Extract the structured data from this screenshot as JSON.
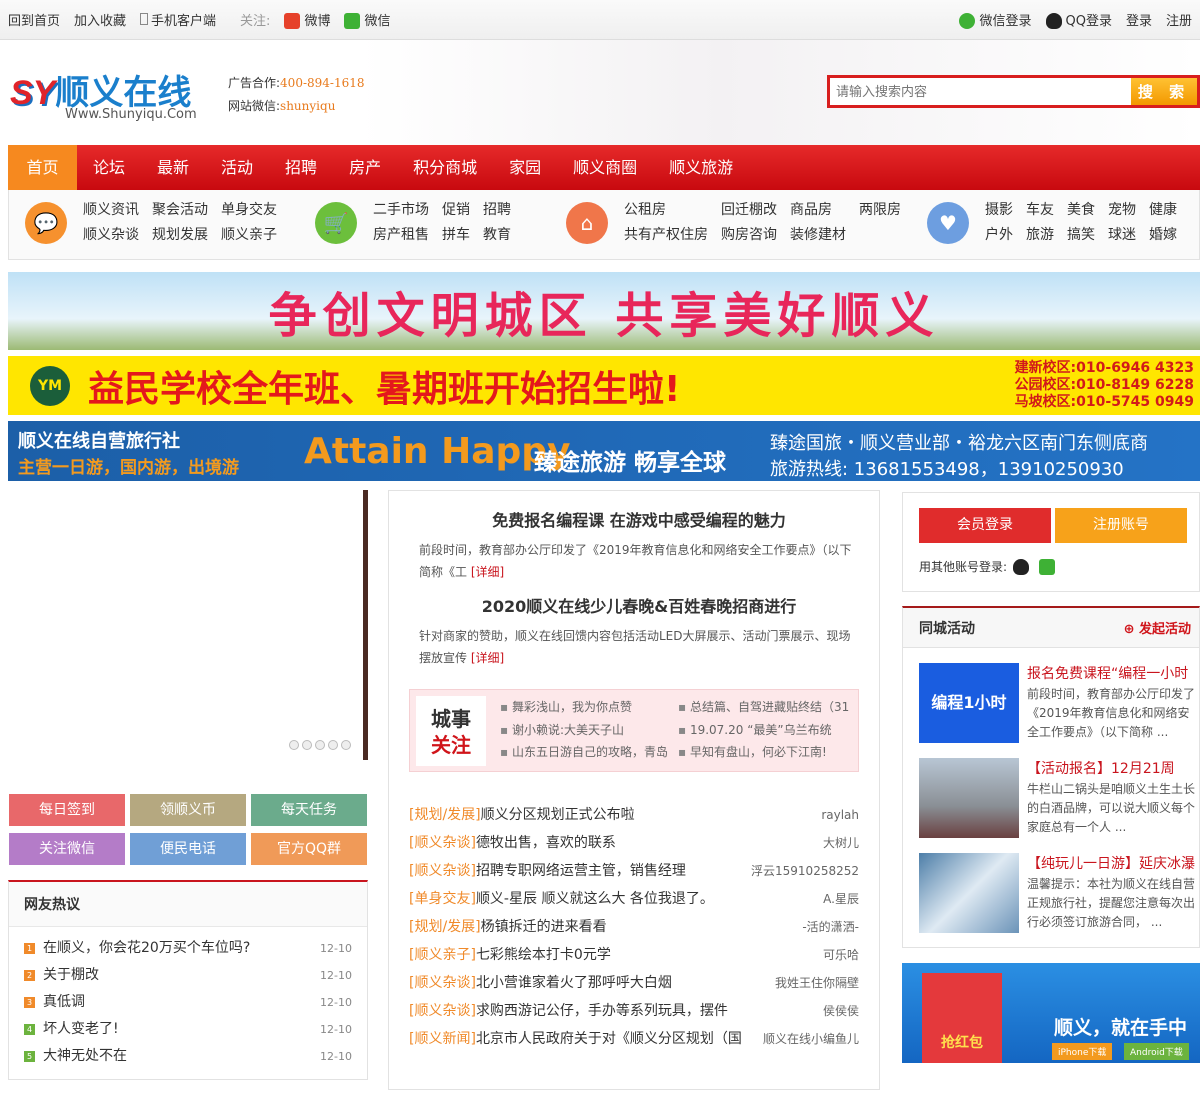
{
  "topbar": {
    "home": "回到首页",
    "fav": "加入收藏",
    "mobile": "手机客户端",
    "follow": "关注:",
    "weibo": "微博",
    "weixin": "微信",
    "wx_login": "微信登录",
    "qq_login": "QQ登录",
    "login": "登录",
    "register": "注册"
  },
  "header": {
    "logo_mark": "SY",
    "logo_name": "顺义在线",
    "logo_url": "Www.Shunyiqu.Com",
    "ad_label": "广告合作:",
    "ad_phone": "400-894-1618",
    "wx_label": "网站微信:",
    "wx_id": "shunyiqu",
    "search_placeholder": "请输入搜索内容",
    "search_button": "搜 索"
  },
  "nav": [
    "首页",
    "论坛",
    "最新",
    "活动",
    "招聘",
    "房产",
    "积分商城",
    "家园",
    "顺义商圈",
    "顺义旅游"
  ],
  "cats": [
    {
      "links": [
        "顺义资讯",
        "聚会活动",
        "单身交友",
        "顺义杂谈",
        "规划发展",
        "顺义亲子"
      ],
      "color": "#f6912e"
    },
    {
      "links": [
        "二手市场",
        "促销",
        "招聘",
        "房产租售",
        "拼车",
        "教育"
      ],
      "color": "#6cbf3c"
    },
    {
      "links": [
        "公租房",
        "回迁棚改",
        "商品房",
        "两限房",
        "共有产权住房",
        "购房咨询",
        "装修建材"
      ],
      "color": "#f0764a"
    },
    {
      "links": [
        "摄影",
        "车友",
        "美食",
        "宠物",
        "健康",
        "户外",
        "旅游",
        "搞笑",
        "球迷",
        "婚嫁"
      ],
      "color": "#6d9ee0"
    }
  ],
  "banners": {
    "b1": "争创文明城区  共享美好顺义",
    "b2_logo": "YM",
    "b2": "益民学校全年班、暑期班开始招生啦!",
    "b2_phones": [
      "建新校区:010-6946 4323",
      "公园校区:010-8149 6228",
      "马坡校区:010-5745 0949"
    ],
    "b3_title": "顺义在线自营旅行社",
    "b3_sub": "主营一日游，国内游，出境游",
    "b3_brand": "Attain Happy",
    "b3_slogan": "臻途旅游  畅享全球",
    "b3_addr": "臻途国旅・顺义营业部・裕龙六区南门东侧底商",
    "b3_hotline": "旅游热线: 13681553498，13910250930"
  },
  "quick": [
    {
      "label": "每日签到",
      "color": "#e8686a"
    },
    {
      "label": "领顺义币",
      "color": "#b5a880"
    },
    {
      "label": "每天任务",
      "color": "#6bab8c"
    },
    {
      "label": "关注微信",
      "color": "#b47cc8"
    },
    {
      "label": "便民电话",
      "color": "#709fd6"
    },
    {
      "label": "官方QQ群",
      "color": "#f09a58"
    }
  ],
  "hot": {
    "title": "网友热议",
    "items": [
      {
        "t": "在顺义，你会花20万买个车位吗?",
        "d": "12-10",
        "n": "1",
        "c": "#f08a2a"
      },
      {
        "t": "关于棚改",
        "d": "12-10",
        "n": "2",
        "c": "#f08a2a"
      },
      {
        "t": "真低调",
        "d": "12-10",
        "n": "3",
        "c": "#f08a2a"
      },
      {
        "t": "坏人变老了!",
        "d": "12-10",
        "n": "4",
        "c": "#6cb33e"
      },
      {
        "t": "大神无处不在",
        "d": "12-10",
        "n": "5",
        "c": "#6cb33e"
      }
    ]
  },
  "articles": [
    {
      "title": "免费报名编程课  在游戏中感受编程的魅力",
      "desc": "前段时间，教育部办公厅印发了《2019年教育信息化和网络安全工作要点》（以下简称《工",
      "more": "[详细]"
    },
    {
      "title": "2020顺义在线少儿春晚&百姓春晚招商进行",
      "desc": "针对商家的赞助，顺义在线回馈内容包括活动LED大屏展示、活动门票展示、现场摆放宣传",
      "more": "[详细]"
    }
  ],
  "focus": {
    "l1": "城事",
    "l2": "关注",
    "items": [
      "舞彩浅山，我为你点赞",
      "总结篇、自驾进藏贴终结（31",
      "谢小赖说:大美天子山",
      "19.07.20 “最美”乌兰布统",
      "山东五日游自己的攻略，青岛",
      "早知有盘山，何必下江南!"
    ]
  },
  "threads": [
    {
      "c": "[规划/发展]",
      "t": "顺义分区规划正式公布啦",
      "u": "raylah"
    },
    {
      "c": "[顺义杂谈]",
      "t": "德牧出售，喜欢的联系",
      "u": "大树儿"
    },
    {
      "c": "[顺义杂谈]",
      "t": "招聘专职网络运营主管，销售经理",
      "u": "浮云15910258252"
    },
    {
      "c": "[单身交友]",
      "t": "顺义-星辰 顺义就这么大 各位我退了。",
      "u": "A.星辰"
    },
    {
      "c": "[规划/发展]",
      "t": "杨镇拆迁的进来看看",
      "u": "-活的潇洒-"
    },
    {
      "c": "[顺义亲子]",
      "t": "七彩熊绘本打卡0元学",
      "u": "可乐哈"
    },
    {
      "c": "[顺义杂谈]",
      "t": "北小营谁家着火了那呼呼大白烟",
      "u": "我姓王住你隔壁"
    },
    {
      "c": "[顺义杂谈]",
      "t": "求购西游记公仔，手办等系列玩具，摆件",
      "u": "侯侯侯"
    },
    {
      "c": "[顺义新闻]",
      "t": "北京市人民政府关于对《顺义分区规划（国",
      "u": "顺义在线小编鱼儿"
    }
  ],
  "login": {
    "member": "会员登录",
    "register": "注册账号",
    "other": "用其他账号登录:"
  },
  "activities": {
    "title": "同城活动",
    "create": "发起活动",
    "items": [
      {
        "title": "报名免费课程“编程一小时",
        "desc": "前段时间，教育部办公厅印发了《2019年教育信息化和网络安全工作要点》（以下简称 ...",
        "img": "编程1小时"
      },
      {
        "title": "【活动报名】12月21周",
        "desc": "牛栏山二锅头是咱顺义土生土长的白酒品牌，可以说大顺义每个家庭总有一个人 ..."
      },
      {
        "title": "【纯玩儿一日游】延庆冰瀑",
        "desc": "温馨提示：本社为顺义在线自营正规旅行社，提醒您注意每次出行必须签订旅游合同，  ..."
      }
    ]
  },
  "app": {
    "slogan": "顺义，就在手中",
    "btn1": "iPhone下载",
    "btn2": "Android下载",
    "img": "抢红包"
  }
}
